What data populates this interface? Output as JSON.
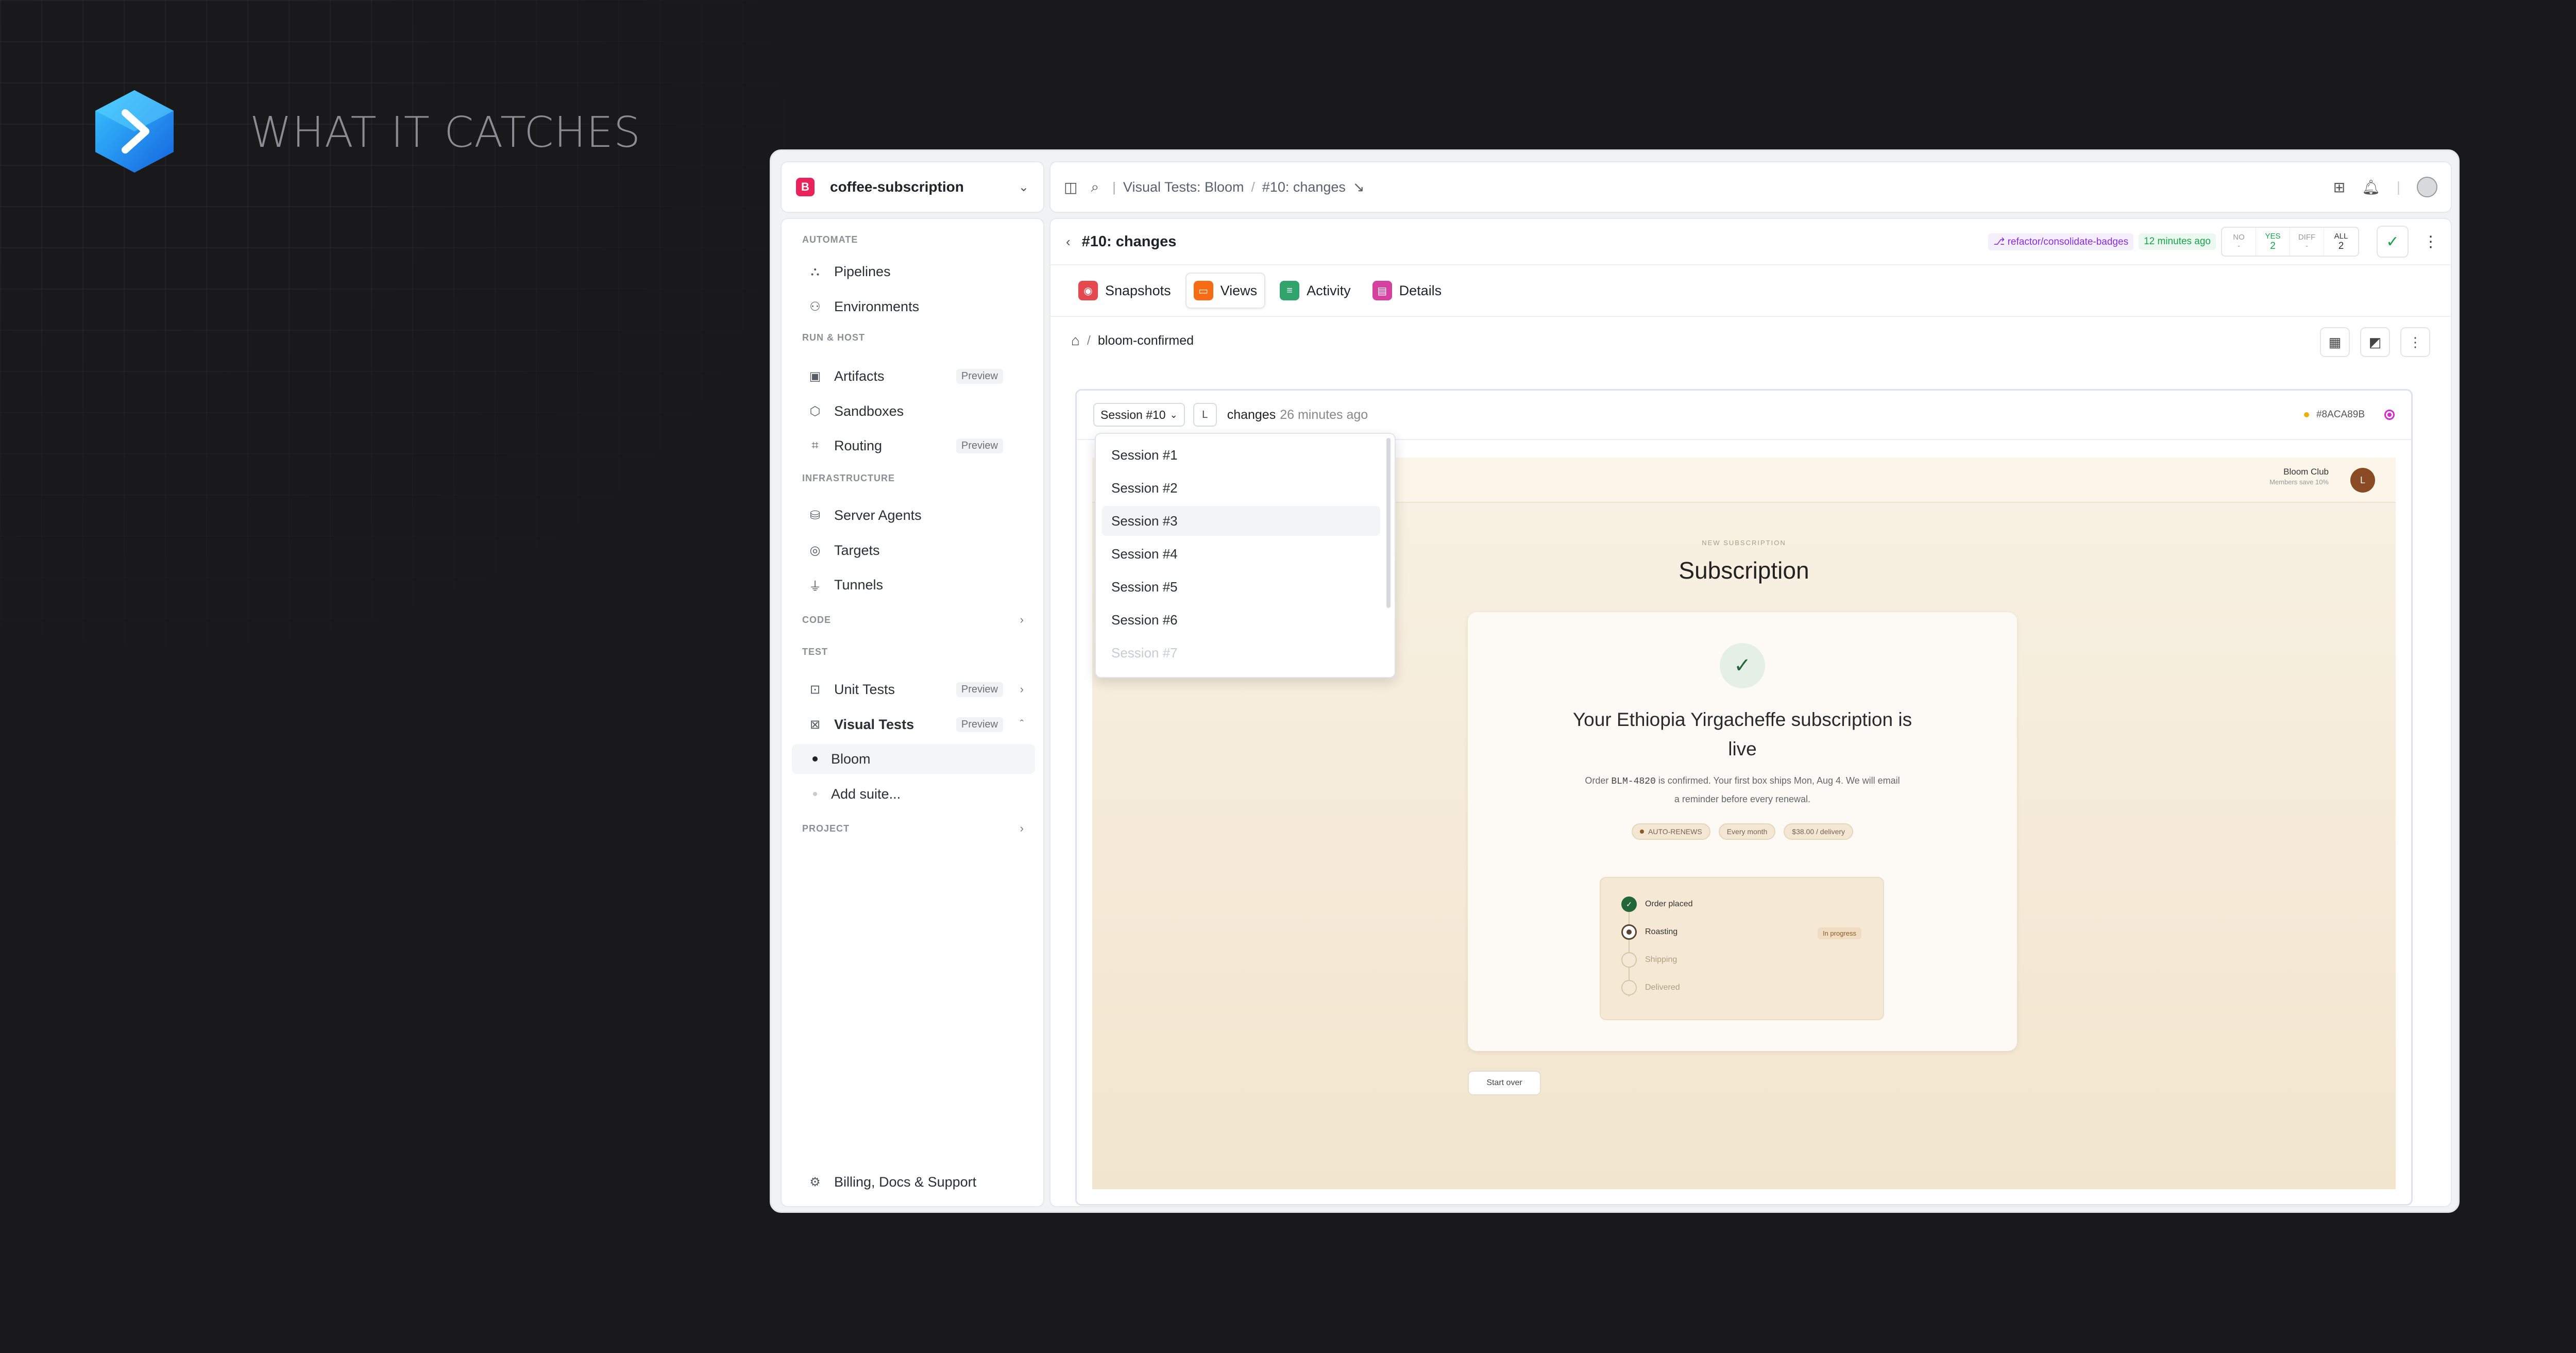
{
  "tagline": "WHAT IT CATCHES",
  "project": {
    "badge": "B",
    "name": "coffee-subscription"
  },
  "sidebar": {
    "sections": [
      "AUTOMATE",
      "RUN & HOST",
      "INFRASTRUCTURE",
      "CODE",
      "TEST",
      "PROJECT"
    ],
    "items": [
      {
        "label": "Pipelines",
        "icon": "pipeline-icon"
      },
      {
        "label": "Environments",
        "icon": "environments-icon"
      },
      {
        "label": "Artifacts",
        "icon": "artifacts-icon",
        "badge": "Preview"
      },
      {
        "label": "Sandboxes",
        "icon": "sandbox-icon"
      },
      {
        "label": "Routing",
        "icon": "routing-icon",
        "badge": "Preview"
      },
      {
        "label": "Server Agents",
        "icon": "server-agents-icon"
      },
      {
        "label": "Targets",
        "icon": "targets-icon"
      },
      {
        "label": "Tunnels",
        "icon": "tunnels-icon"
      },
      {
        "label": "Unit Tests",
        "icon": "unit-tests-icon",
        "badge": "Preview"
      },
      {
        "label": "Visual Tests",
        "icon": "visual-tests-icon",
        "badge": "Preview"
      },
      {
        "label": "Bloom"
      },
      {
        "label": "Add suite..."
      }
    ],
    "footer": "Billing, Docs & Support"
  },
  "topbar": {
    "crumbs": [
      "Visual Tests: Bloom",
      "#10: changes"
    ]
  },
  "header": {
    "title": "#10: changes",
    "branch": "refactor/consolidate-badges",
    "ago": "12 minutes ago",
    "counts": [
      {
        "label": "NO",
        "value": "-"
      },
      {
        "label": "YES",
        "value": "2"
      },
      {
        "label": "DIFF",
        "value": "-"
      },
      {
        "label": "ALL",
        "value": "2"
      }
    ]
  },
  "tabs": [
    {
      "label": "Snapshots",
      "color": "#e5484d"
    },
    {
      "label": "Views",
      "color": "#f76b15"
    },
    {
      "label": "Activity",
      "color": "#30a46c"
    },
    {
      "label": "Details",
      "color": "#d6409f"
    }
  ],
  "path": {
    "current": "bloom-confirmed"
  },
  "viewer": {
    "session": "Session #10",
    "l_badge": "L",
    "change_label": "changes",
    "change_time": "26 minutes ago",
    "hash": "#8ACA89B"
  },
  "dropdown": [
    "Session #1",
    "Session #2",
    "Session #3",
    "Session #4",
    "Session #5",
    "Session #6",
    "Session #7"
  ],
  "snapshot": {
    "club_name": "Bloom Club",
    "club_sub": "Members save 10%",
    "avatar": "L",
    "eyebrow": "NEW SUBSCRIPTION",
    "title": "Subscription",
    "headline": "Your Ethiopia Yirgacheffe subscription is live",
    "conf_pre": "Order",
    "order_id": "BLM-4820",
    "conf_post": "is confirmed. Your first box ships Mon, Aug 4. We will email a reminder before every renewal.",
    "pills": [
      "AUTO-RENEWS",
      "Every month",
      "$38.00 / delivery"
    ],
    "steps": [
      "Order placed",
      "Roasting",
      "Shipping",
      "Delivered"
    ],
    "in_progress": "In progress",
    "start_over": "Start over"
  }
}
